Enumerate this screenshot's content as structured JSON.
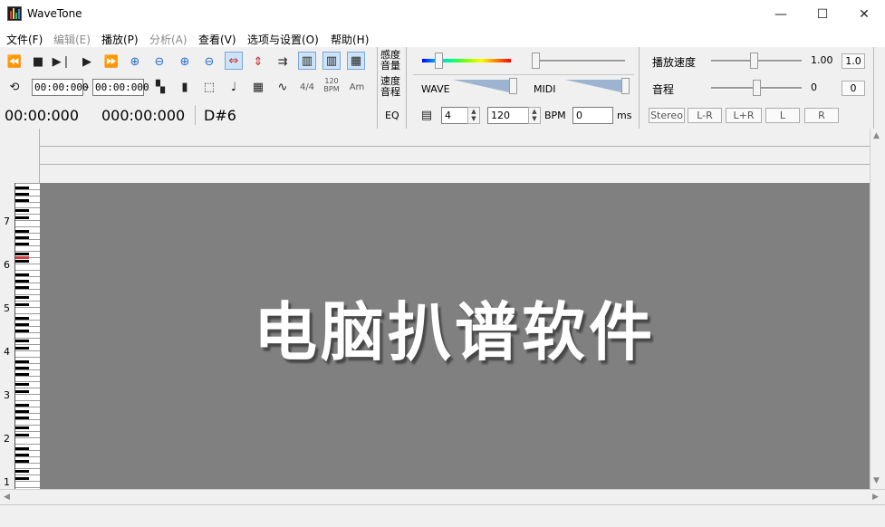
{
  "window": {
    "title": "WaveTone",
    "minimize_glyph": "—",
    "maximize_glyph": "☐",
    "close_glyph": "✕"
  },
  "menu": [
    {
      "label": "文件(F)",
      "enabled": true
    },
    {
      "label": "编辑(E)",
      "enabled": false
    },
    {
      "label": "播放(P)",
      "enabled": true
    },
    {
      "label": "分析(A)",
      "enabled": false
    },
    {
      "label": "查看(V)",
      "enabled": true
    },
    {
      "label": "选项与设置(O)",
      "enabled": true
    },
    {
      "label": "帮助(H)",
      "enabled": true
    }
  ],
  "toolbar": {
    "start_time": "00:00:000",
    "end_time": "00:00:000",
    "tempo_icon_top": "120",
    "tempo_icon_bottom": "BPM",
    "meter_icon": "4/4",
    "key_icon": "Am",
    "position_time": "00:00:000",
    "total_time": "000:00:000",
    "note": "D#6",
    "sensitivity_label": "感度 音量",
    "speed_label": "速度 音程",
    "eq_label": "EQ",
    "wave_label": "WAVE",
    "midi_label": "MIDI",
    "beats_value": "4",
    "bpm_value": "120",
    "bpm_label": "BPM",
    "offset_value": "0",
    "ms_label": "ms",
    "playback_speed_label": "播放速度",
    "playback_speed_value": "1.00",
    "playback_speed_reset": "1.0",
    "pitch_label": "音程",
    "pitch_value": "0",
    "pitch_reset": "0",
    "channel_buttons": [
      "Stereo",
      "L-R",
      "L+R",
      "L",
      "R"
    ]
  },
  "piano": {
    "octave_labels": [
      "7",
      "6",
      "5",
      "4",
      "3",
      "2",
      "1"
    ]
  },
  "canvas": {
    "watermark": "电脑扒谱软件"
  },
  "colors": {
    "canvas_bg": "#808080",
    "highlight_key": "#d04040"
  }
}
